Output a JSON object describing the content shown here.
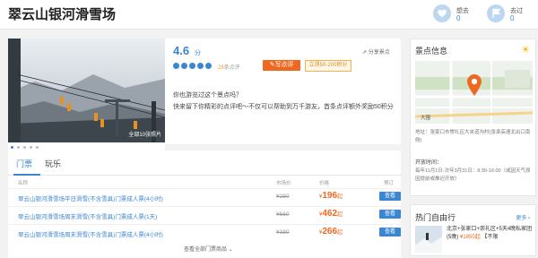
{
  "header": {
    "title": "翠云山银河滑雪场",
    "want_label": "想去",
    "want_count": "0",
    "been_label": "去过",
    "been_count": "0"
  },
  "photo": {
    "caption": "全部10张照片",
    "slide_total": 5
  },
  "rating": {
    "score": "4.6",
    "score_unit": "分",
    "stars": 5,
    "review_count": "28",
    "review_suffix": "条点评",
    "write_button": "写点评",
    "points_badge": "立得50-200积分",
    "share": "分享景点",
    "prompt_question": "你也游览过这个景点吗？",
    "prompt_detail": "快来留下你精彩的点评吧～不仅可以帮助到万千游友，首条点评额外奖励50积分"
  },
  "tickets": {
    "tabs": [
      "门票",
      "玩乐"
    ],
    "active_tab": 0,
    "columns": [
      "名称",
      "市场价",
      "价格",
      "预订"
    ],
    "rows": [
      {
        "name": "翠云山银河滑雪场平日滑雪(不含雪具)门票成人票(4小时)",
        "market": "¥280",
        "currency": "¥",
        "price": "196",
        "price_suffix": "起",
        "button": "查看"
      },
      {
        "name": "翠云山银河滑雪场周末滑雪(不含雪具)门票成人票(1天)",
        "market": "¥660",
        "currency": "¥",
        "price": "462",
        "price_suffix": "起",
        "button": "查看"
      },
      {
        "name": "翠云山银河滑雪场周末滑雪(不含雪具)门票成人票(4小时)",
        "market": "¥380",
        "currency": "¥",
        "price": "266",
        "price_suffix": "起",
        "button": "查看"
      }
    ],
    "more": "查看全部门票商品"
  },
  "sidebar": {
    "title": "景点信息",
    "map_label": "大围",
    "address": "地址：张家口市崇礼区大夹道沟村(张承高速北出口南侧)",
    "open_label": "开放时间：",
    "open_text": "每年11月1日-次年3月31日：8:30-16:00（或因天气原因提前或推迟开放）"
  },
  "tours": {
    "title": "热门自由行",
    "more": "更多",
    "item_text": "北京+张家口+崇礼区+5天4晚私家团(5晚)",
    "item_price": "¥1850起",
    "item_tag": "【不限"
  },
  "colors": {
    "accent": "#3a86d1",
    "orange": "#f06820"
  }
}
